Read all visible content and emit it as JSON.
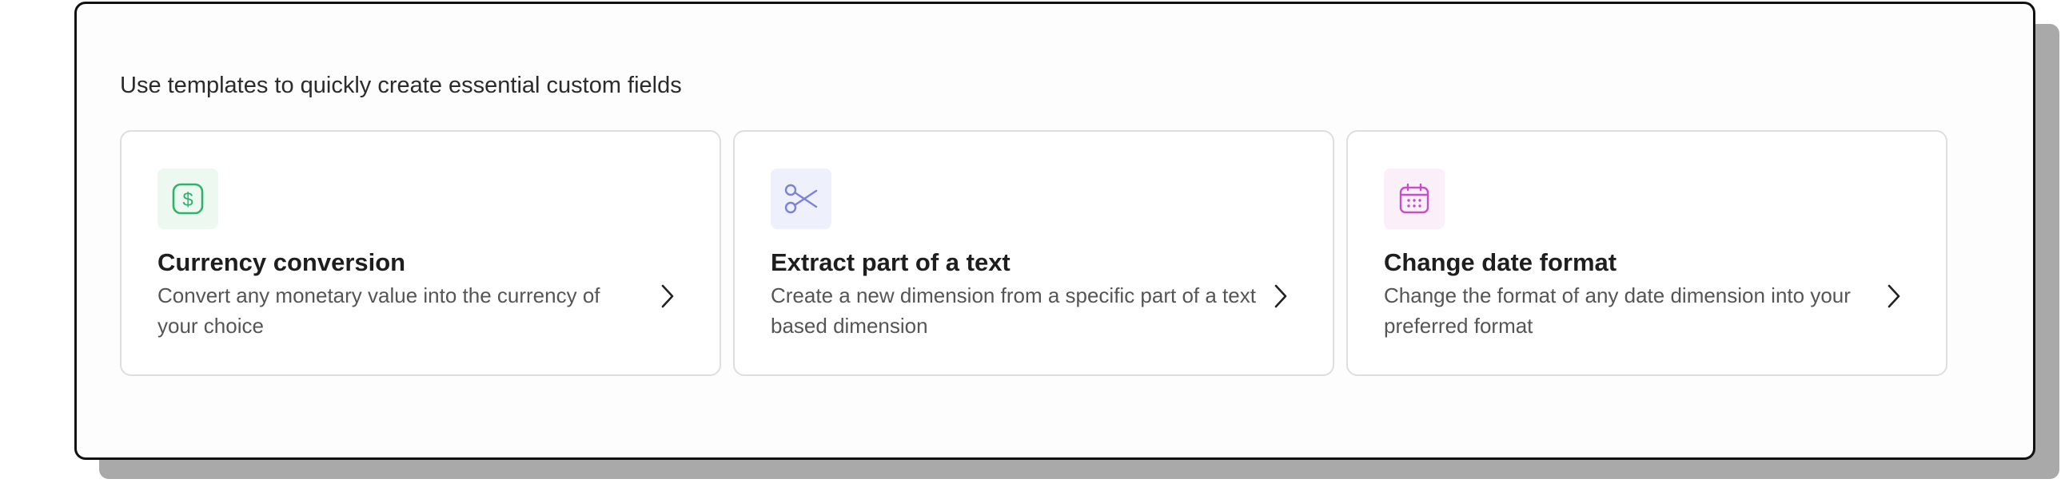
{
  "panel": {
    "heading": "Use templates to quickly create essential custom fields"
  },
  "templates": [
    {
      "title": "Currency conversion",
      "description": "Convert any monetary value into the currency of your choice",
      "icon": "dollar-icon",
      "icon_color": "#2fb36b"
    },
    {
      "title": "Extract part of a text",
      "description": "Create a new dimension from a specific part of a text based dimension",
      "icon": "scissors-icon",
      "icon_color": "#7b83d6"
    },
    {
      "title": "Change date format",
      "description": "Change the format of any date dimension into your preferred format",
      "icon": "calendar-icon",
      "icon_color": "#c64fc6"
    }
  ]
}
